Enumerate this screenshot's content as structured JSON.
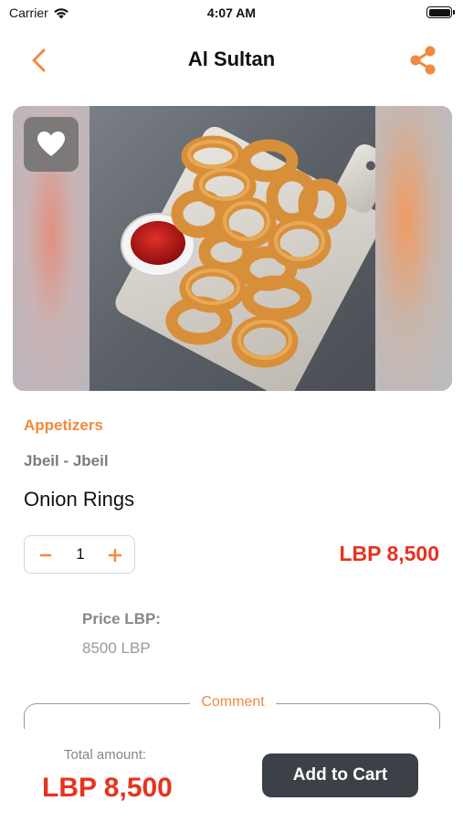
{
  "status_bar": {
    "carrier": "Carrier",
    "time": "4:07 AM",
    "icons": [
      "wifi-icon",
      "battery-icon"
    ]
  },
  "nav": {
    "title": "Al Sultan",
    "back_icon": "chevron-left-icon",
    "share_icon": "share-icon"
  },
  "hero": {
    "image_subject": "onion rings with ketchup on a wooden board",
    "favorite_icon": "heart-icon"
  },
  "product": {
    "category": "Appetizers",
    "location": "Jbeil - Jbeil",
    "name": "Onion Rings",
    "quantity": "1",
    "price_display": "LBP 8,500",
    "price_label": "Price LBP:",
    "price_value": "8500 LBP"
  },
  "comment": {
    "label": "Comment",
    "value": ""
  },
  "footer": {
    "total_label": "Total amount:",
    "total_value": "LBP 8,500",
    "add_to_cart_label": "Add to Cart"
  },
  "colors": {
    "accent": "#f08a3e",
    "price": "#e8321e",
    "button_dark": "#3b4147"
  }
}
